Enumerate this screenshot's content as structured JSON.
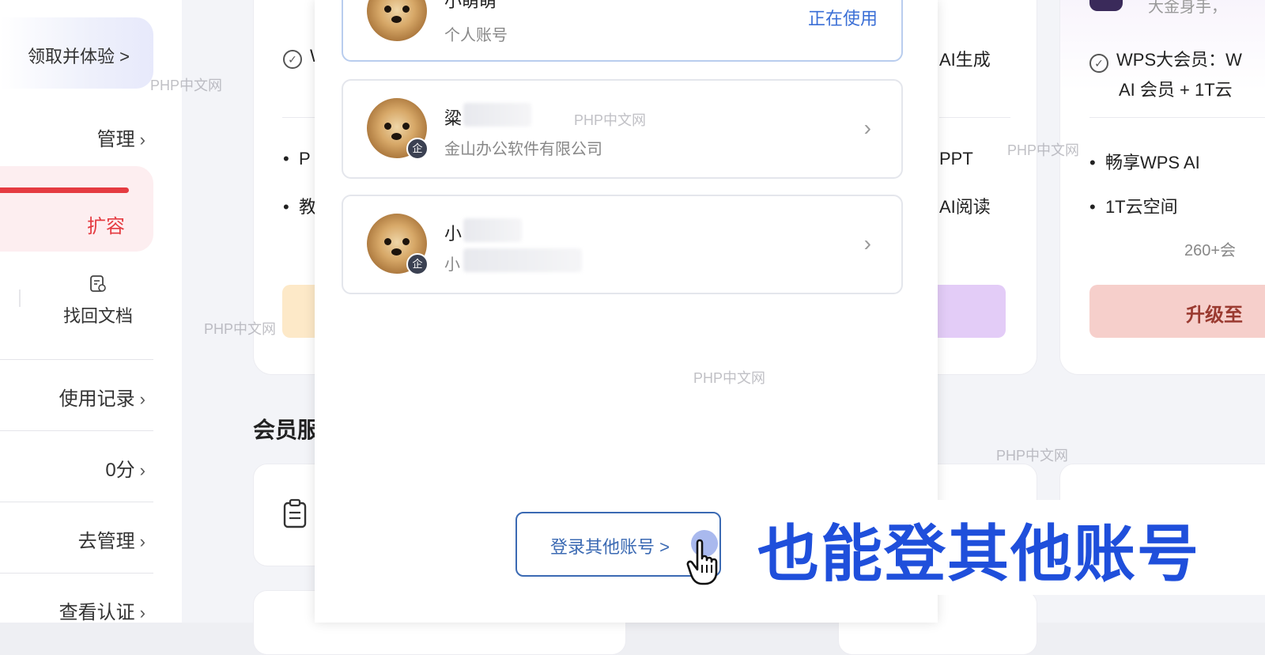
{
  "sidebar": {
    "trial_label": "领取并体验 >",
    "manage_label": "管理",
    "expand_label": "扩容",
    "recover_label": "找回文档",
    "usage_label": "使用记录",
    "points_label": "0分",
    "go_manage_label": "去管理",
    "verify_label": "查看认证"
  },
  "plans": {
    "left_feature_partial": "W",
    "left_bullet_1": "P",
    "left_bullet_2": "教",
    "mid_feature_partial": "AI生成",
    "mid_bullet_1": "PPT",
    "mid_bullet_2": "AI阅读",
    "right_partial_top": "大金身手，",
    "right_feature_line1": "WPS大会员：W",
    "right_feature_line2": "AI 会员 + 1T云",
    "right_bullet_1": "畅享WPS AI",
    "right_bullet_2": "1T云空间",
    "right_more": "260+会",
    "right_button": "升级至"
  },
  "section": {
    "members_title": "会员服"
  },
  "modal": {
    "accounts": [
      {
        "name": "小萌萌",
        "subtitle": "个人账号",
        "status": "正在使用",
        "enterprise": false
      },
      {
        "name": "粱",
        "subtitle": "金山办公软件有限公司",
        "status": "",
        "enterprise": true
      },
      {
        "name": "小",
        "subtitle": "小",
        "status": "",
        "enterprise": true
      }
    ],
    "enterprise_badge": "企",
    "login_other_label": "登录其他账号 >"
  },
  "caption": "也能登其他账号",
  "watermark": "PHP中文网",
  "colors": {
    "accent_red": "#e53b41",
    "modal_link_blue": "#3b6ab3",
    "caption_blue": "#1f4fdb",
    "status_blue": "#3b6fd6"
  }
}
